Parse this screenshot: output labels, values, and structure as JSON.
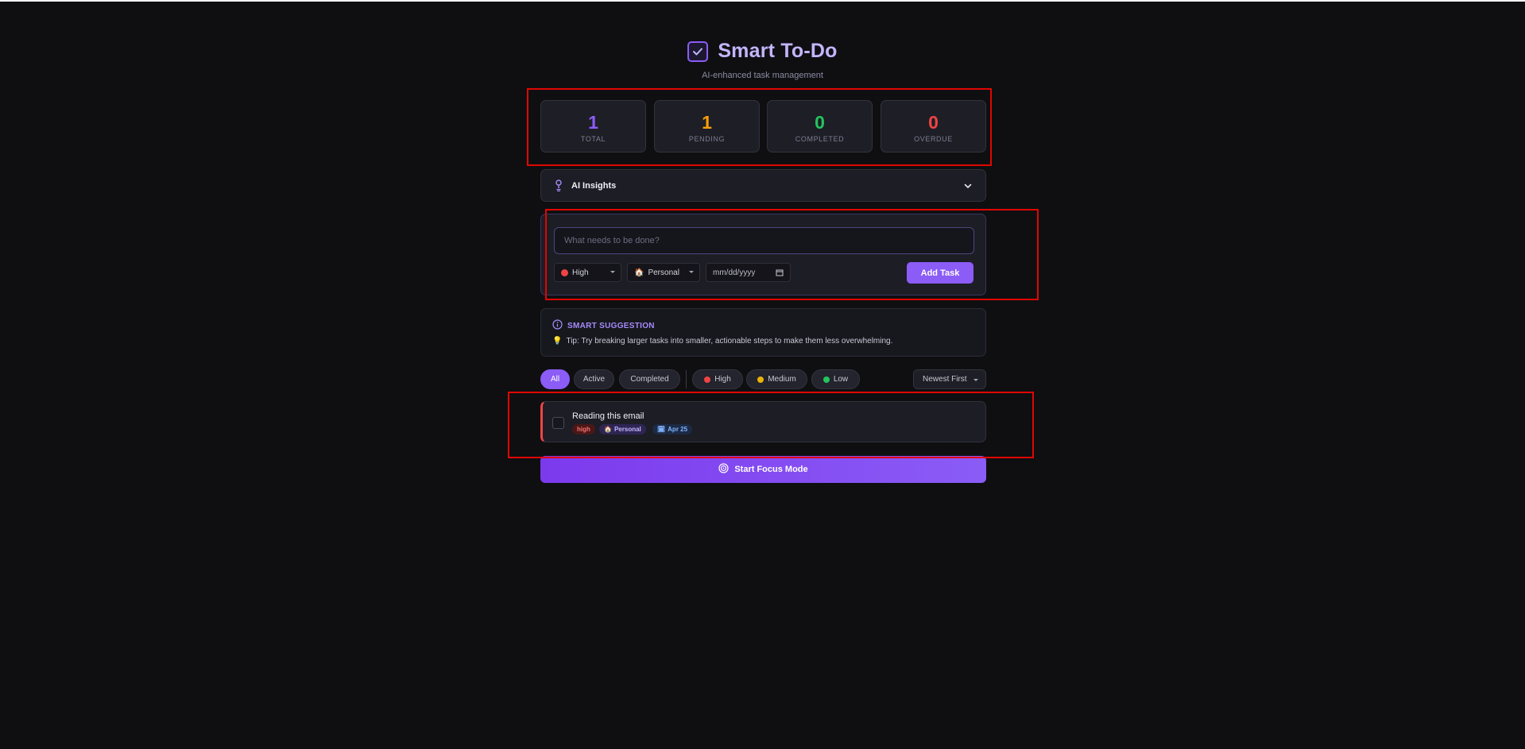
{
  "app": {
    "title": "Smart To-Do",
    "subtitle": "AI-enhanced task management"
  },
  "stats": [
    {
      "value": "1",
      "label": "TOTAL",
      "color": "#8b5cf6"
    },
    {
      "value": "1",
      "label": "PENDING",
      "color": "#f59e0b"
    },
    {
      "value": "0",
      "label": "COMPLETED",
      "color": "#22c55e"
    },
    {
      "value": "0",
      "label": "OVERDUE",
      "color": "#ef4444"
    }
  ],
  "insights": {
    "label": "AI Insights",
    "icon": "lightbulb-icon"
  },
  "form": {
    "task_placeholder": "What needs to be done?",
    "priority_value": "High",
    "category_value": "Personal",
    "date_placeholder": "mm/dd/yyyy",
    "add_label": "Add Task"
  },
  "suggestion": {
    "heading": "SMART SUGGESTION",
    "text": "Tip: Try breaking larger tasks into smaller, actionable steps to make them less overwhelming."
  },
  "filters": {
    "status": [
      "All",
      "Active",
      "Completed"
    ],
    "priority": [
      "High",
      "Medium",
      "Low"
    ],
    "sort_label": "Newest First"
  },
  "tasks": [
    {
      "title": "Reading this email",
      "priority": "high",
      "category": "Personal",
      "due": "Apr 25"
    }
  ],
  "focus": {
    "label": "Start Focus Mode"
  },
  "colors": {
    "accent": "#8b5cf6",
    "high": "#ef4444",
    "medium": "#eab308",
    "low": "#22c55e",
    "highlight_box": "#e10600"
  }
}
